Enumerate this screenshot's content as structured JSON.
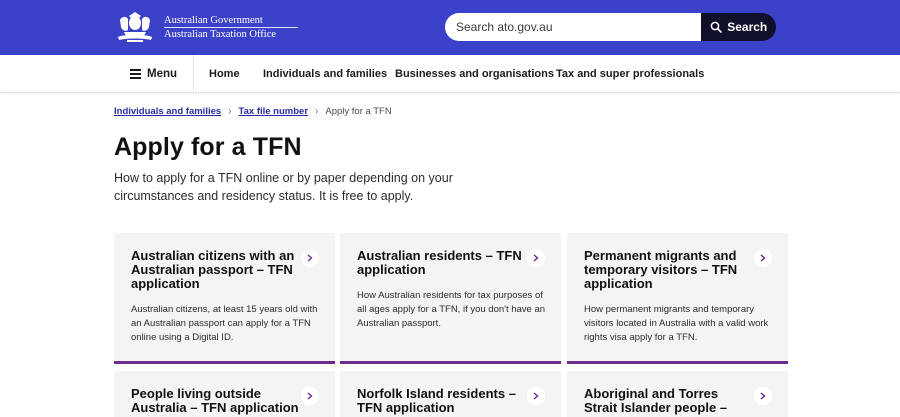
{
  "header": {
    "logo_line1": "Australian Government",
    "logo_line2": "Australian Taxation Office",
    "search_placeholder": "Search ato.gov.au",
    "search_button": "Search",
    "brand_color": "#3c41c9"
  },
  "nav": {
    "menu_label": "Menu",
    "links": [
      "Home",
      "Individuals and families",
      "Businesses and organisations",
      "Tax and super professionals"
    ]
  },
  "breadcrumb": {
    "items": [
      "Individuals and families",
      "Tax file number"
    ],
    "current": "Apply for a TFN"
  },
  "page": {
    "title": "Apply for a TFN",
    "intro": "How to apply for a TFN online or by paper depending on your circumstances and residency status. It is free to apply."
  },
  "cards": [
    {
      "title": "Australian citizens with an Australian passport – TFN application",
      "desc": "Australian citizens, at least 15 years old with an Australian passport can apply for a TFN online using a Digital ID."
    },
    {
      "title": "Australian residents – TFN application",
      "desc": "How Australian residents for tax purposes of all ages apply for a TFN, if you don't have an Australian passport."
    },
    {
      "title": "Permanent migrants and temporary visitors – TFN application",
      "desc": "How permanent migrants and temporary visitors located in Australia with a valid work rights visa apply for a TFN."
    },
    {
      "title": "People living outside Australia – TFN application",
      "desc": ""
    },
    {
      "title": "Norfolk Island residents – TFN application",
      "desc": ""
    },
    {
      "title": "Aboriginal and Torres Strait Islander people – TFN",
      "desc": ""
    }
  ],
  "colors": {
    "card_accent": "#6a2d8c",
    "link": "#2a2aa0"
  }
}
